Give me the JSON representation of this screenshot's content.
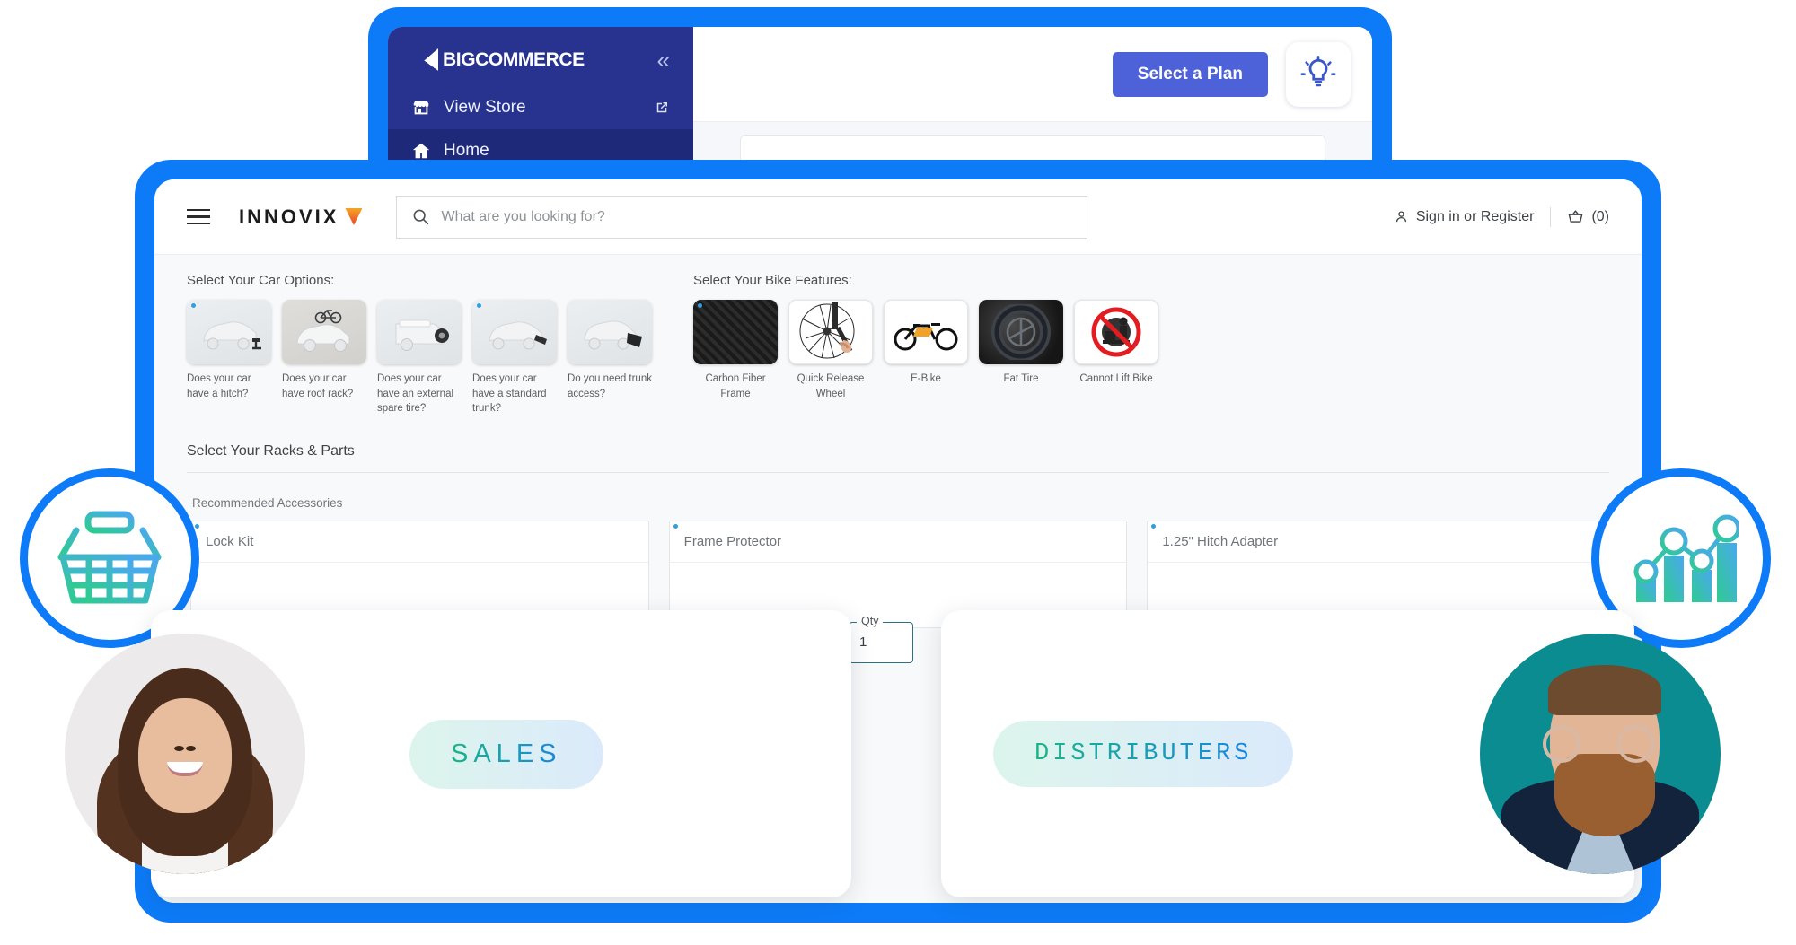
{
  "admin": {
    "brand": {
      "prefix": "BIG",
      "suffix": "COMMERCE",
      "logo_icon": "bigcommerce-logo-icon"
    },
    "collapse_icon": "chevron-double-left-icon",
    "nav": [
      {
        "label": "View Store",
        "icon": "store-icon",
        "trailing_icon": "external-link-icon"
      },
      {
        "label": "Home",
        "icon": "home-icon"
      }
    ],
    "topbar": {
      "plan_button": "Select a Plan",
      "tips_icon": "lightbulb-icon"
    }
  },
  "storefront": {
    "header": {
      "menu_icon": "hamburger-menu-icon",
      "logo_text": "INNOVIX",
      "logo_mark_icon": "triangle-mark-icon",
      "search": {
        "icon": "search-icon",
        "placeholder": "What are you looking for?",
        "value": ""
      },
      "account_label": "Sign in or Register",
      "account_icon": "person-icon",
      "cart_icon": "basket-icon",
      "cart_count": "(0)"
    },
    "car_options": {
      "title": "Select Your Car Options:",
      "tiles": [
        {
          "label": "Does your car have a hitch?",
          "icon": "car-hitch-icon",
          "selected": true
        },
        {
          "label": "Does your car have roof rack?",
          "icon": "car-roof-rack-icon",
          "selected": false
        },
        {
          "label": "Does your car have an external spare tire?",
          "icon": "car-spare-tire-icon",
          "selected": false
        },
        {
          "label": "Does your car have a standard trunk?",
          "icon": "car-standard-trunk-icon",
          "selected": true
        },
        {
          "label": "Do you need trunk access?",
          "icon": "car-trunk-access-icon",
          "selected": false
        }
      ]
    },
    "bike_features": {
      "title": "Select Your Bike Features:",
      "tiles": [
        {
          "label": "Carbon Fiber Frame",
          "icon": "carbon-fiber-icon",
          "selected": true
        },
        {
          "label": "Quick Release Wheel",
          "icon": "quick-release-wheel-icon",
          "selected": false
        },
        {
          "label": "E-Bike",
          "icon": "e-bike-icon",
          "selected": false
        },
        {
          "label": "Fat Tire",
          "icon": "fat-tire-icon",
          "selected": false
        },
        {
          "label": "Cannot Lift Bike",
          "icon": "no-lift-bike-icon",
          "selected": false
        }
      ]
    },
    "racks": {
      "title": "Select Your Racks & Parts",
      "subtitle": "Recommended Accessories",
      "accessories": [
        {
          "name": "Lock Kit",
          "selected": true
        },
        {
          "name": "Frame Protector",
          "selected": true
        },
        {
          "name": "1.25\" Hitch Adapter",
          "selected": true
        }
      ]
    },
    "qty_field": {
      "label": "Qty",
      "value": "1"
    }
  },
  "badges": [
    {
      "name": "shopping-basket",
      "icon": "basket-gradient-icon"
    },
    {
      "name": "analytics",
      "icon": "bar-chart-line-gradient-icon"
    }
  ],
  "persona_cards": [
    {
      "pill_label": "SALES",
      "portrait": "woman-portrait"
    },
    {
      "pill_label": "DISTRIBUTERS",
      "portrait": "man-portrait"
    }
  ],
  "colors": {
    "frame_blue": "#0d7bf7",
    "admin_navy": "#27338e",
    "plan_button": "#4d61d8",
    "accent_green": "#19b588",
    "accent_blue": "#1a86e0",
    "selection_dot": "#2f9fe0"
  }
}
